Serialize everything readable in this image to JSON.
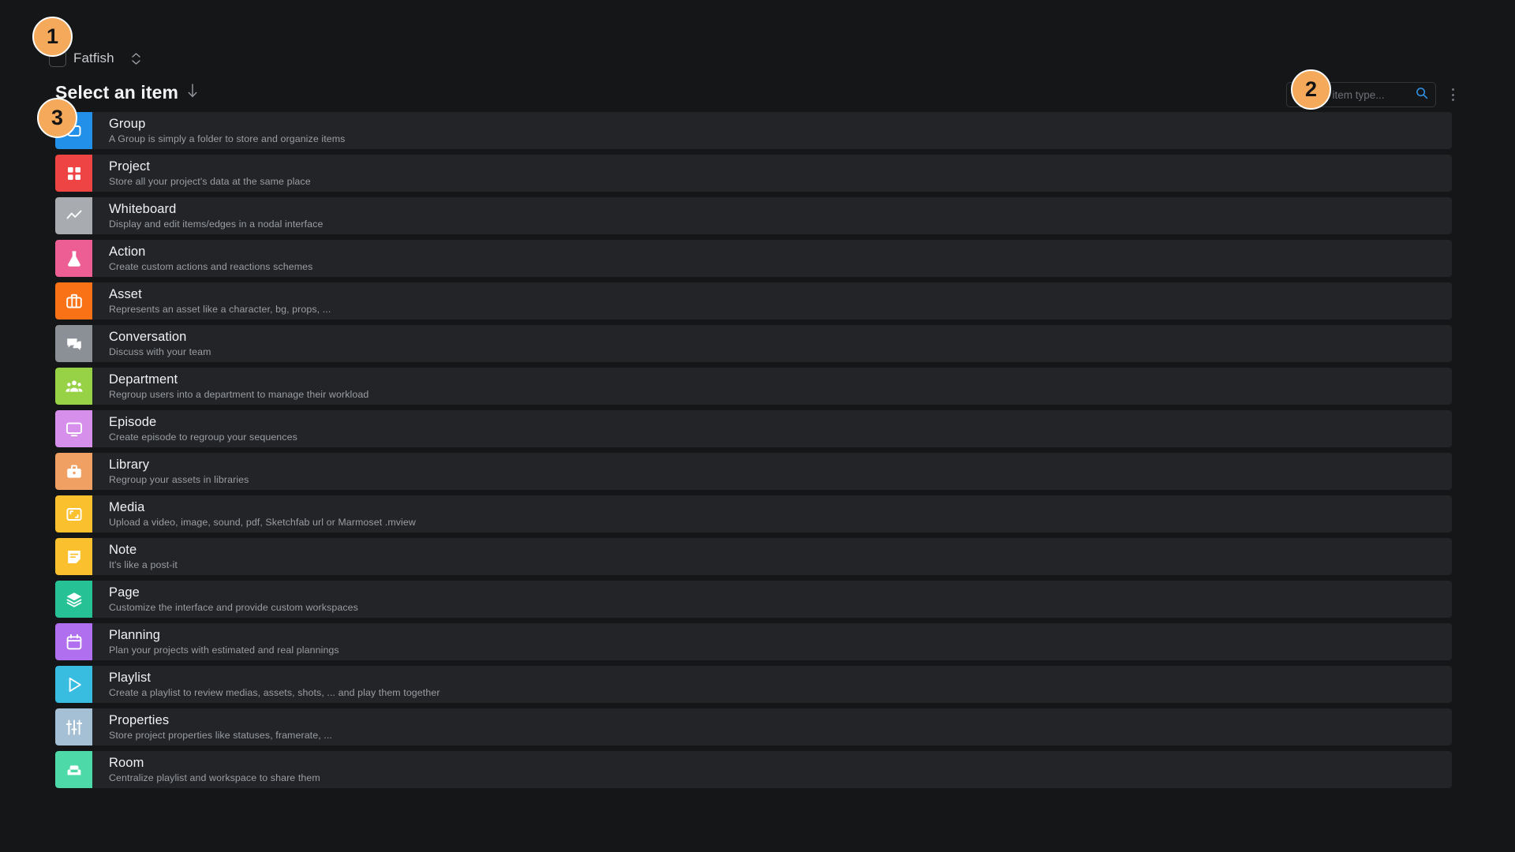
{
  "workspace": {
    "name": "Fatfish",
    "thumb_icon": "workspace-thumbnail-icon",
    "selector_icon": "chevron-up-down-icon"
  },
  "header": {
    "title": "Select an item",
    "sort_icon": "arrow-down-icon"
  },
  "search": {
    "placeholder": "Search item type...",
    "value": "",
    "icon": "search-icon",
    "icon_color": "#2f8fe0",
    "menu_icon": "more-vertical-icon"
  },
  "theme": {
    "page_background": "#151618",
    "row_background": "#222427",
    "title_color": "#f0f1f3",
    "desc_color": "#9a9ea4",
    "badge_color": "#f5a95a"
  },
  "annotations": [
    {
      "number": "1",
      "target": "workspace-selector"
    },
    {
      "number": "2",
      "target": "search-input"
    },
    {
      "number": "3",
      "target": "item-row-group"
    }
  ],
  "items": [
    {
      "label": "Group",
      "desc": "A Group is simply a folder to store and organize items",
      "icon": "folder-outline-icon",
      "color": "#2290e8"
    },
    {
      "label": "Project",
      "desc": "Store all your project's data at the same place",
      "icon": "grid-squares-icon",
      "color": "#ef4444"
    },
    {
      "label": "Whiteboard",
      "desc": "Display and edit items/edges in a nodal interface",
      "icon": "polyline-chart-icon",
      "color": "#a8abb0"
    },
    {
      "label": "Action",
      "desc": "Create custom actions and reactions schemes",
      "icon": "flask-icon",
      "color": "#ec5e94"
    },
    {
      "label": "Asset",
      "desc": "Represents an asset like a character, bg, props, ...",
      "icon": "briefcase-icon",
      "color": "#f97316"
    },
    {
      "label": "Conversation",
      "desc": "Discuss with your team",
      "icon": "chat-bubbles-icon",
      "color": "#8b8f96"
    },
    {
      "label": "Department",
      "desc": "Regroup users into a department to manage their workload",
      "icon": "people-group-icon",
      "color": "#97d145"
    },
    {
      "label": "Episode",
      "desc": "Create episode to regroup your sequences",
      "icon": "monitor-icon",
      "color": "#d68fea"
    },
    {
      "label": "Library",
      "desc": "Regroup your assets in libraries",
      "icon": "briefcase-filled-icon",
      "color": "#f0a063"
    },
    {
      "label": "Media",
      "desc": "Upload a video, image, sound, pdf, Sketchfab url or Marmoset .mview",
      "icon": "image-frame-icon",
      "color": "#fbc02d"
    },
    {
      "label": "Note",
      "desc": "It's like a post-it",
      "icon": "sticky-note-icon",
      "color": "#fbc02d"
    },
    {
      "label": "Page",
      "desc": "Customize the interface and provide custom workspaces",
      "icon": "layers-icon",
      "color": "#26c195"
    },
    {
      "label": "Planning",
      "desc": "Plan your projects with estimated and real plannings",
      "icon": "calendar-icon",
      "color": "#b06fee"
    },
    {
      "label": "Playlist",
      "desc": "Create a playlist to review medias, assets, shots, ... and play them together",
      "icon": "play-triangle-icon",
      "color": "#38bde0"
    },
    {
      "label": "Properties",
      "desc": "Store project properties like statuses, framerate, ...",
      "icon": "sliders-icon",
      "color": "#a5c0d4"
    },
    {
      "label": "Room",
      "desc": "Centralize playlist and workspace to share them",
      "icon": "sofa-icon",
      "color": "#4ed9a8"
    }
  ]
}
